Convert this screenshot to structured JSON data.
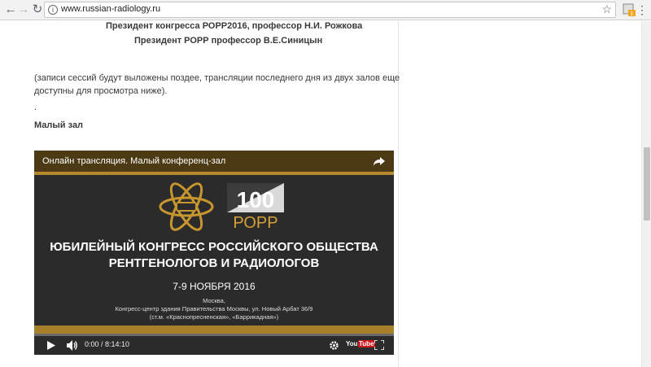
{
  "browser": {
    "back_icon": "back-arrow-icon",
    "forward_icon": "forward-arrow-icon",
    "reload_icon": "reload-icon",
    "url": "www.russian-radiology.ru",
    "extension_badge": "1"
  },
  "page": {
    "line1": "Президент конгресса РОРР2016, профессор Н.И. Рожкова",
    "line2": "Президент РОРР профессор В.Е.Синицын",
    "note_line1": "(записи сессий будут выложены поздее, трансляции последнего дня из двух залов еще",
    "note_line2": "доступны для просмотра ниже).",
    "dot": ".",
    "section": "Малый зал"
  },
  "video": {
    "title": "Онлайн трансляция. Малый конференц-зал",
    "poster_logo_number": "100",
    "poster_logo_text": "РОРР",
    "poster_title_1": "ЮБИЛЕЙНЫЙ КОНГРЕСС РОССИЙСКОГО ОБЩЕСТВА",
    "poster_title_2": "РЕНТГЕНОЛОГОВ И РАДИОЛОГОВ",
    "poster_dates": "7-9 НОЯБРЯ 2016",
    "poster_addr_1": "Москва,",
    "poster_addr_2": "Конгресс-центр здания Правительства Москвы, ул. Новый Арбат 36/9",
    "poster_addr_3": "(ст.м. «Краснопресненская», «Баррикадная»)",
    "time": "0:00 / 8:14:10",
    "progress": 0.0,
    "youtube_label": "YouTube"
  },
  "colors": {
    "accent_gold": "#b5892e",
    "player_bg": "#2b2b2b",
    "progress_red": "#cc181e"
  }
}
